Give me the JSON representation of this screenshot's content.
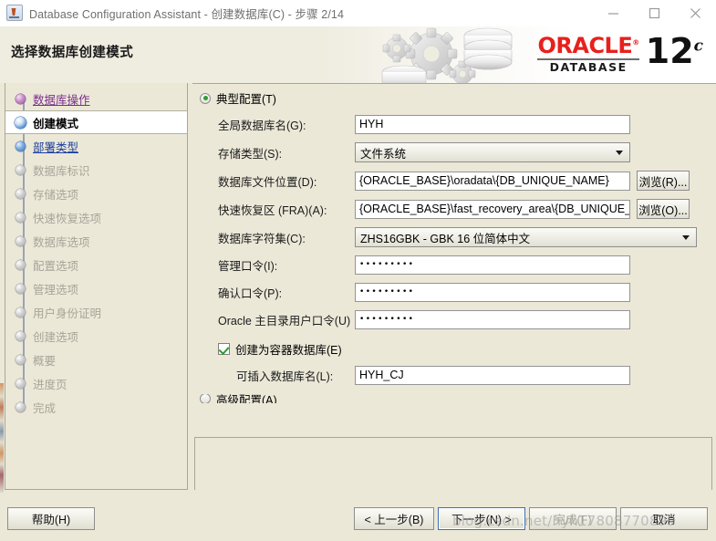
{
  "window": {
    "title": "Database Configuration Assistant - 创建数据库(C) - 步骤 2/14",
    "app_icon": "java-app-icon",
    "minimize_label": "minimize",
    "maximize_label": "maximize",
    "close_label": "close"
  },
  "banner": {
    "title": "选择数据库创建模式",
    "logo_word": "ORACLE",
    "logo_reg": "®",
    "logo_sub": "DATABASE",
    "logo_version": "12",
    "logo_version_suffix": "c"
  },
  "sidebar": {
    "steps": [
      {
        "label": "数据库操作",
        "state": "done"
      },
      {
        "label": "创建模式",
        "state": "current"
      },
      {
        "label": "部署类型",
        "state": "next"
      },
      {
        "label": "数据库标识",
        "state": "disabled"
      },
      {
        "label": "存储选项",
        "state": "disabled"
      },
      {
        "label": "快速恢复选项",
        "state": "disabled"
      },
      {
        "label": "数据库选项",
        "state": "disabled"
      },
      {
        "label": "配置选项",
        "state": "disabled"
      },
      {
        "label": "管理选项",
        "state": "disabled"
      },
      {
        "label": "用户身份证明",
        "state": "disabled"
      },
      {
        "label": "创建选项",
        "state": "disabled"
      },
      {
        "label": "概要",
        "state": "disabled"
      },
      {
        "label": "进度页",
        "state": "disabled"
      },
      {
        "label": "完成",
        "state": "disabled"
      }
    ]
  },
  "main": {
    "typical_radio_label": "典型配置(T)",
    "typical_radio_selected": true,
    "advanced_radio_label": "高级配置(A)",
    "advanced_radio_selected": false,
    "fields": {
      "global_db_name_label": "全局数据库名(G):",
      "global_db_name_value": "HYH",
      "storage_type_label": "存储类型(S):",
      "storage_type_value": "文件系统",
      "db_file_location_label": "数据库文件位置(D):",
      "db_file_location_value": "{ORACLE_BASE}\\oradata\\{DB_UNIQUE_NAME}",
      "db_file_browse_label": "浏览(R)...",
      "fra_label": "快速恢复区 (FRA)(A):",
      "fra_value": "{ORACLE_BASE}\\fast_recovery_area\\{DB_UNIQUE_N/",
      "fra_browse_label": "浏览(O)...",
      "charset_label": "数据库字符集(C):",
      "charset_value": "ZHS16GBK - GBK 16 位简体中文",
      "admin_password_label": "管理口令(I):",
      "admin_password_value": "•••••••••",
      "confirm_password_label": "确认口令(P):",
      "confirm_password_value": "•••••••••",
      "oracle_home_password_label": "Oracle 主目录用户口令(U)",
      "oracle_home_password_value": "•••••••••",
      "container_db_label": "创建为容器数据库(E)",
      "container_db_checked": true,
      "pluggable_db_label": "可插入数据库名(L):",
      "pluggable_db_value": "HYH_CJ"
    }
  },
  "footer": {
    "help_label": "帮助(H)",
    "back_label": "< 上一步(B)",
    "next_label": "下一步(N) >",
    "finish_label": "完成(F)",
    "cancel_label": "取消"
  },
  "watermark": {
    "text": "blog.csdn.net/hyh17808770899"
  }
}
